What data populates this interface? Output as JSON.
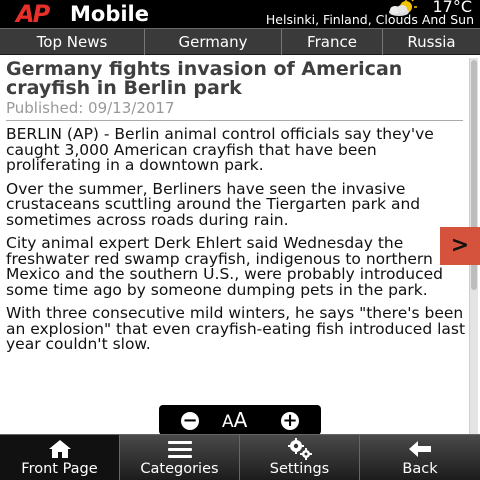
{
  "header": {
    "logo_ap": "AP",
    "logo_mobile": "Mobile",
    "temperature": "17°C",
    "weather_icon": "partly-cloudy-icon",
    "location": "Helsinki, Finland, Clouds And Sun"
  },
  "tabs": [
    {
      "label": "Top News"
    },
    {
      "label": "Germany"
    },
    {
      "label": "France"
    },
    {
      "label": "Russia"
    }
  ],
  "article": {
    "headline": "Germany fights invasion of American crayfish in Berlin park",
    "published": "Published: 09/13/2017",
    "paragraphs": [
      "BERLIN (AP) - Berlin animal control officials say they've caught 3,000 American crayfish that have been proliferating in a downtown park.",
      "Over the summer, Berliners have seen the invasive crustaceans scuttling around the Tiergarten park and sometimes across roads during rain.",
      "City animal expert Derk Ehlert said Wednesday the freshwater red swamp crayfish, indigenous to northern Mexico and the southern U.S., were probably introduced some time ago by someone dumping pets in the park.",
      "With three consecutive mild winters, he says \"there's been an explosion\" that even crayfish-eating fish introduced last year couldn't slow."
    ]
  },
  "next_arrow": ">",
  "font_controls": {
    "decrease": "−",
    "label_small": "A",
    "label_big": "A",
    "increase": "+"
  },
  "bottom_bar": [
    {
      "label": "Front Page",
      "icon": "home-icon",
      "active": true
    },
    {
      "label": "Categories",
      "icon": "list-icon",
      "active": false
    },
    {
      "label": "Settings",
      "icon": "gear-icon",
      "active": false
    },
    {
      "label": "Back",
      "icon": "back-arrow-icon",
      "active": false
    }
  ],
  "colors": {
    "brand_red": "#e8302a",
    "next_arrow_bg": "#d5533d",
    "header_bg": "#000000"
  }
}
